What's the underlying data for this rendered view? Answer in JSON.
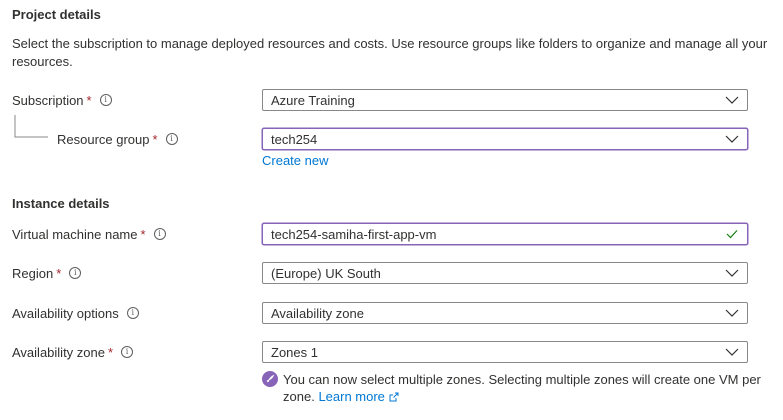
{
  "project": {
    "title": "Project details",
    "description": "Select the subscription to manage deployed resources and costs. Use resource groups like folders to organize and manage all your resources."
  },
  "subscription": {
    "label": "Subscription",
    "required": "*",
    "value": "Azure Training"
  },
  "resource_group": {
    "label": "Resource group",
    "required": "*",
    "value": "tech254",
    "create_new": "Create new"
  },
  "instance": {
    "title": "Instance details"
  },
  "vm_name": {
    "label": "Virtual machine name",
    "required": "*",
    "value": "tech254-samiha-first-app-vm"
  },
  "region": {
    "label": "Region",
    "required": "*",
    "value": "(Europe) UK South"
  },
  "availability_options": {
    "label": "Availability options",
    "value": "Availability zone"
  },
  "availability_zone": {
    "label": "Availability zone",
    "required": "*",
    "value": "Zones 1",
    "message": "You can now select multiple zones. Selecting multiple zones will create one VM per zone.",
    "learn_more": "Learn more"
  },
  "icons": {
    "info": "info-icon",
    "chevron": "chevron-down-icon",
    "check": "checkmark-icon",
    "rocket": "rocket-icon",
    "external": "external-link-icon"
  },
  "colors": {
    "focus_border": "#8764b8",
    "link": "#0078d4",
    "required": "#a4262c",
    "valid": "#107c10"
  }
}
